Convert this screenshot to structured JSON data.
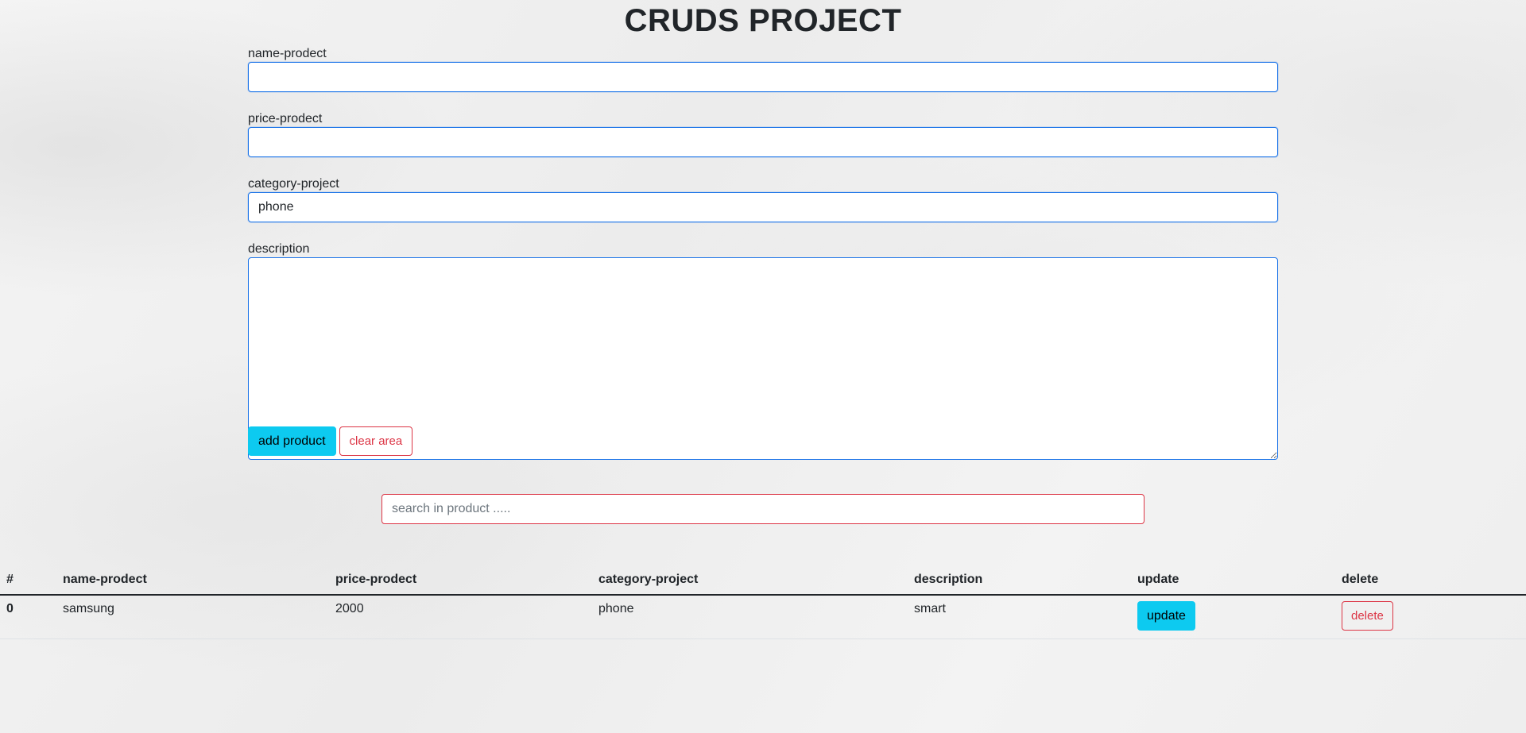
{
  "header": {
    "title": "CRUDS PROJECT"
  },
  "form": {
    "name_label": "name-prodect",
    "name_value": "",
    "price_label": "price-prodect",
    "price_value": "",
    "category_label": "category-project",
    "category_value": "phone",
    "description_label": "description",
    "description_value": "",
    "add_label": "add product",
    "clear_label": "clear area"
  },
  "search": {
    "placeholder": "search in product .....",
    "value": ""
  },
  "table": {
    "headers": [
      "#",
      "name-prodect",
      "price-prodect",
      "category-project",
      "description",
      "update",
      "delete"
    ],
    "rows": [
      {
        "index": "0",
        "name": "samsung",
        "price": "2000",
        "category": "phone",
        "description": "smart",
        "update_label": "update",
        "delete_label": "delete"
      }
    ]
  },
  "colors": {
    "info": "#0dcaf0",
    "danger": "#dc3545",
    "focus_border": "#1a73e8"
  }
}
